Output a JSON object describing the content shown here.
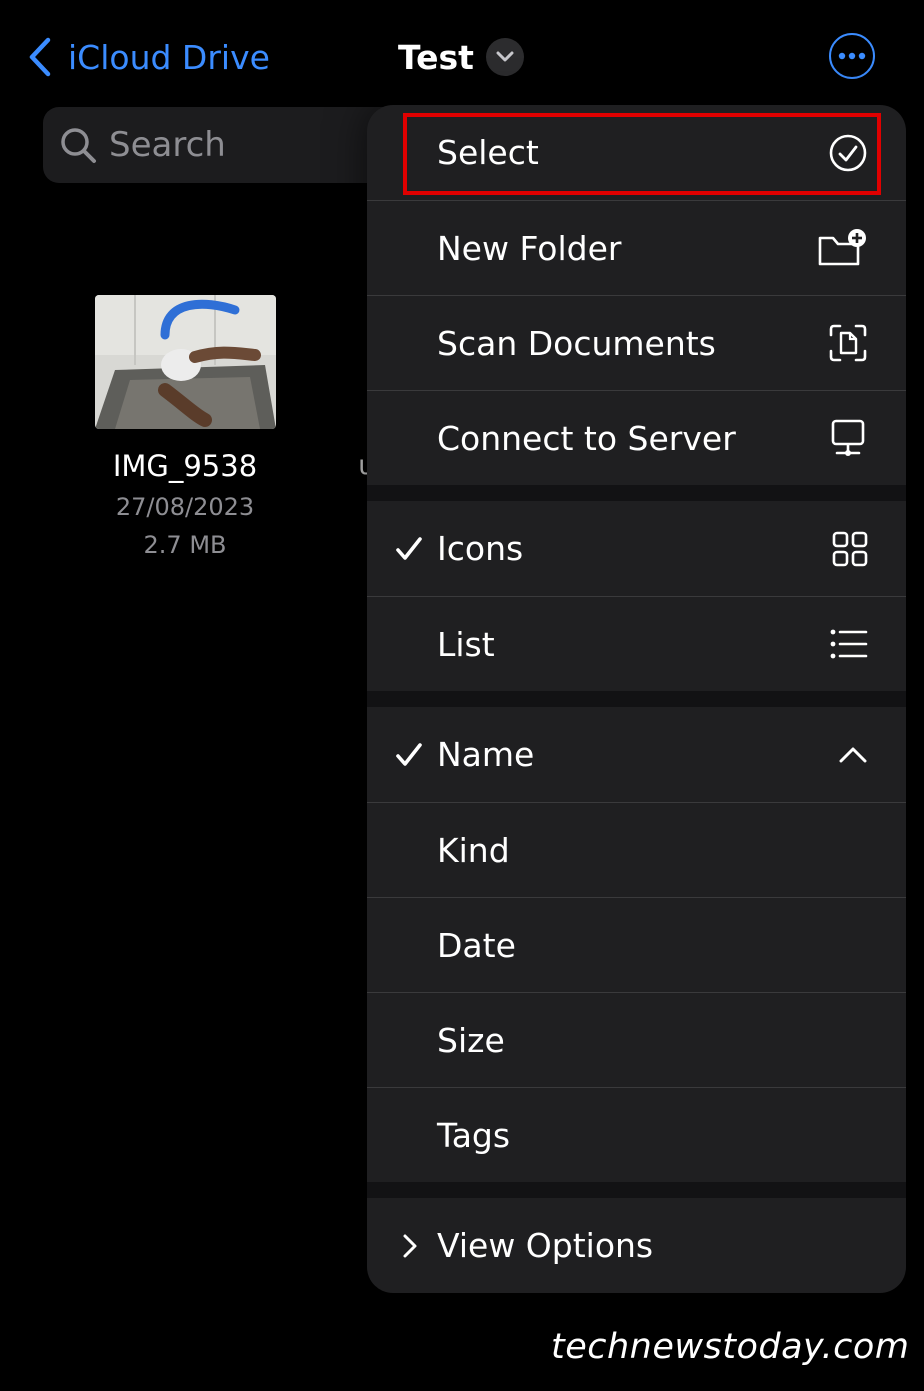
{
  "nav": {
    "back_label": "iCloud Drive",
    "title": "Test"
  },
  "search": {
    "placeholder": "Search"
  },
  "file": {
    "name": "IMG_9538",
    "date": "27/08/2023",
    "size": "2.7 MB"
  },
  "partial_text": "ᴜ",
  "menu": {
    "actions": [
      {
        "label": "Select",
        "icon": "checkmark-circle-icon"
      },
      {
        "label": "New Folder",
        "icon": "new-folder-icon"
      },
      {
        "label": "Scan Documents",
        "icon": "scan-documents-icon"
      },
      {
        "label": "Connect to Server",
        "icon": "server-display-icon"
      }
    ],
    "views": [
      {
        "label": "Icons",
        "icon": "grid-icon",
        "checked": true
      },
      {
        "label": "List",
        "icon": "list-icon",
        "checked": false
      }
    ],
    "sort": [
      {
        "label": "Name",
        "checked": true,
        "icon": "chevron-up-icon"
      },
      {
        "label": "Kind",
        "checked": false
      },
      {
        "label": "Date",
        "checked": false
      },
      {
        "label": "Size",
        "checked": false
      },
      {
        "label": "Tags",
        "checked": false
      }
    ],
    "view_options_label": "View Options"
  },
  "watermark": "technewstoday.com",
  "colors": {
    "accent": "#3b8cff",
    "highlight": "#e00000",
    "menu_bg": "#1f1f21",
    "background": "#000000"
  }
}
